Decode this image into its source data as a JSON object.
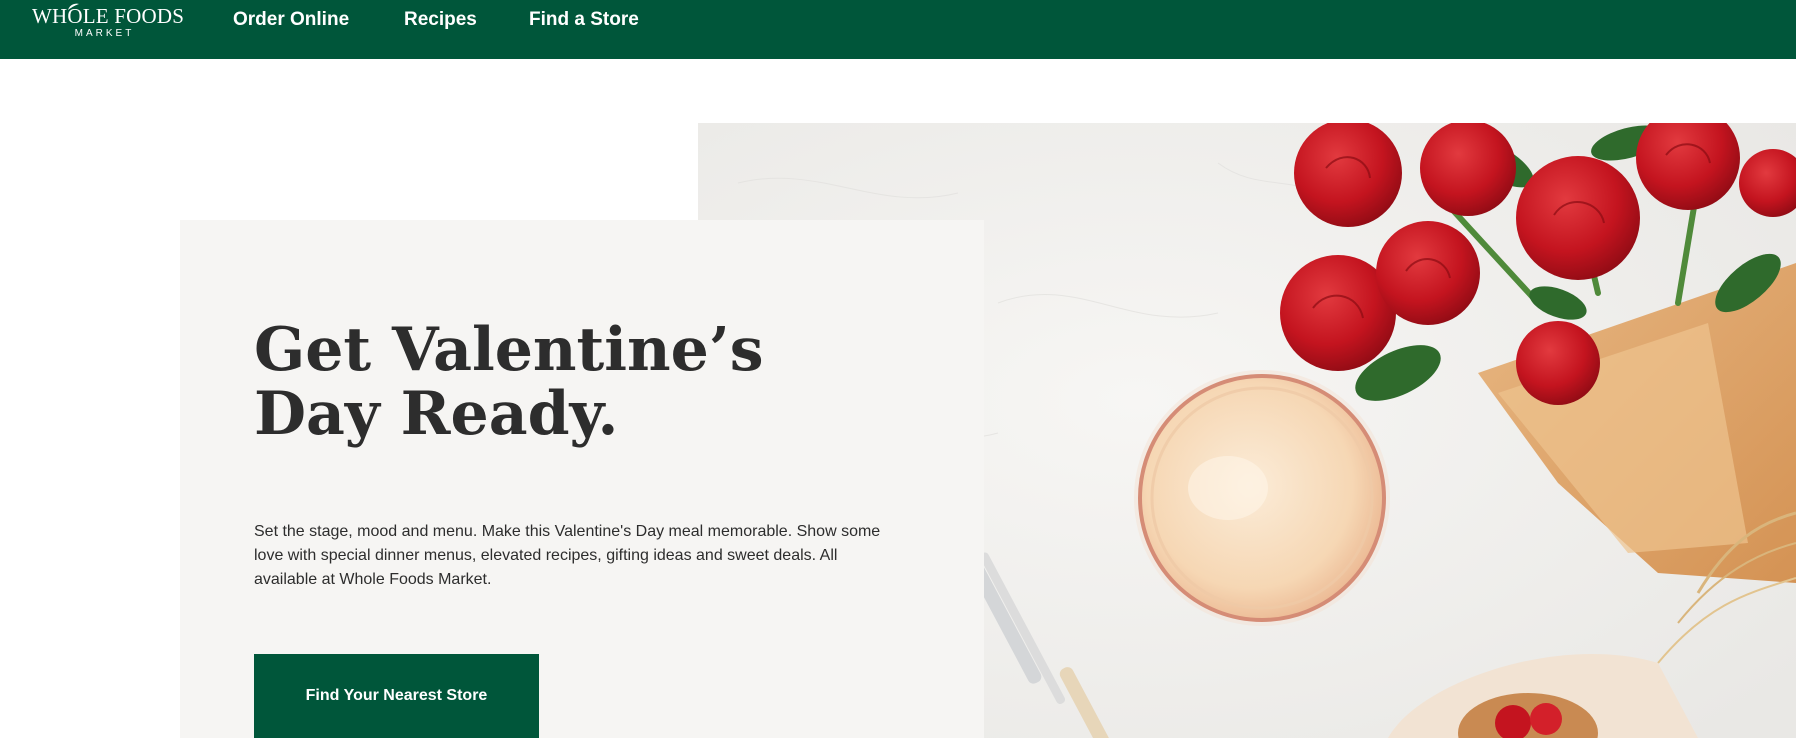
{
  "header": {
    "logo_line1": "WHOLE FOODS",
    "logo_line2": "MARKET",
    "nav": {
      "order_online": "Order Online",
      "recipes": "Recipes",
      "find_store": "Find a Store"
    }
  },
  "hero": {
    "headline": "Get Valentine’s Day Ready.",
    "body": "Set the stage, mood and menu. Make this Valentine's Day meal memorable. Show some love with special dinner menus, elevated recipes, gifting ideas and sweet deals. All available at Whole Foods Market.",
    "cta_label": "Find Your Nearest Store",
    "image_description_icon": "valentines-table-photo"
  },
  "colors": {
    "brand_green": "#00563a",
    "rose_red": "#c4141f",
    "card_bg": "#f6f5f3"
  }
}
